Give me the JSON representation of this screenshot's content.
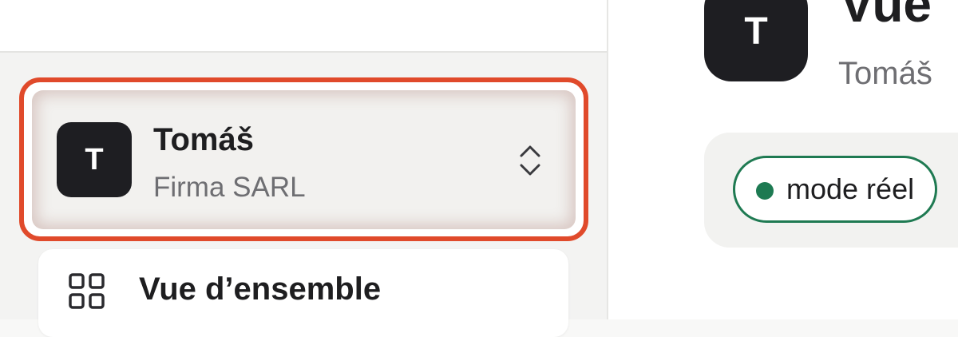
{
  "sidebar": {
    "account": {
      "avatar_initial": "T",
      "name": "Tomáš",
      "organization": "Firma SARL",
      "switcher_icon": "chevron-up-down-icon"
    },
    "nav_items": [
      {
        "label": "Vue d’ensemble",
        "icon": "grid-icon"
      }
    ]
  },
  "main": {
    "avatar_initial": "T",
    "title": "Vue",
    "subtitle": "Tomáš",
    "status": {
      "label": "mode réel",
      "color": "#1d7a52"
    }
  },
  "colors": {
    "highlight": "#e04a2b",
    "avatar_bg": "#1e1e22",
    "status_green": "#1d7a52"
  }
}
